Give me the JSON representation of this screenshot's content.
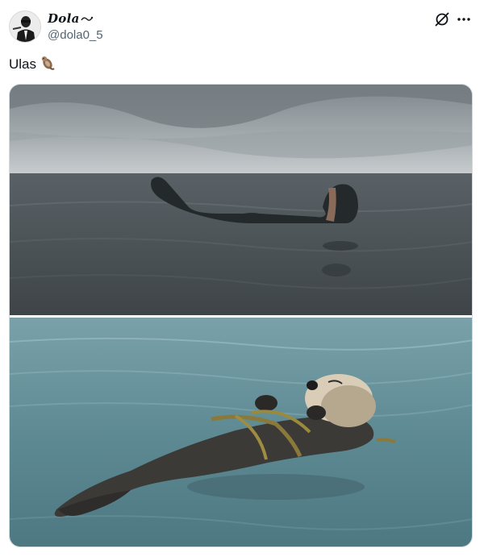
{
  "tweet": {
    "display_name": "Dola",
    "handle": "@dola0_5",
    "text": "Ulas",
    "text_emoji": "otter-emoji",
    "header_icons": [
      "grok-icon",
      "more-icon"
    ]
  },
  "media": {
    "photos": [
      {
        "subject": "man floating on back in the sea"
      },
      {
        "subject": "sea otter floating on back with kelp"
      }
    ]
  },
  "colors": {
    "text": "#0f1419",
    "secondary_text": "#536471",
    "border": "#cfd9de",
    "sky": "#8f979c",
    "sea_gray": "#4f565a",
    "sea_teal": "#5e8a94"
  }
}
